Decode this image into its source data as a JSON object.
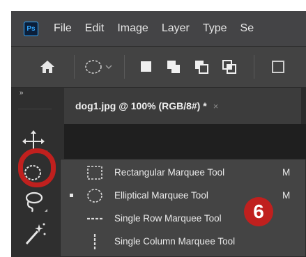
{
  "menubar": {
    "logo": "Ps",
    "items": [
      "File",
      "Edit",
      "Image",
      "Layer",
      "Type",
      "Se"
    ]
  },
  "optionsbar": {
    "icons": [
      "home-icon",
      "elliptical-marquee-preset-icon",
      "chevron-down-icon",
      "new-selection-icon",
      "add-to-selection-icon",
      "subtract-from-selection-icon",
      "intersect-selection-icon"
    ]
  },
  "toolbox": {
    "grip": "»",
    "tools": [
      "move-tool-icon",
      "elliptical-marquee-tool-icon",
      "lasso-tool-icon",
      "magic-wand-tool-icon"
    ]
  },
  "document_tab": {
    "title": "dog1.jpg @ 100% (RGB/8#) *",
    "close": "×"
  },
  "flyout": {
    "items": [
      {
        "label": "Rectangular Marquee Tool",
        "shortcut": "M",
        "icon": "rectangular-marquee-icon",
        "active": false
      },
      {
        "label": "Elliptical Marquee Tool",
        "shortcut": "M",
        "icon": "elliptical-marquee-icon",
        "active": true
      },
      {
        "label": "Single Row Marquee Tool",
        "shortcut": "",
        "icon": "single-row-marquee-icon",
        "active": false
      },
      {
        "label": "Single Column Marquee Tool",
        "shortcut": "",
        "icon": "single-column-marquee-icon",
        "active": false
      }
    ]
  },
  "callout": {
    "number": "6"
  },
  "colors": {
    "highlight": "#c0201e",
    "ps_blue": "#31a8ff",
    "menu_bg": "#444446",
    "flyout_bg": "#444444"
  }
}
